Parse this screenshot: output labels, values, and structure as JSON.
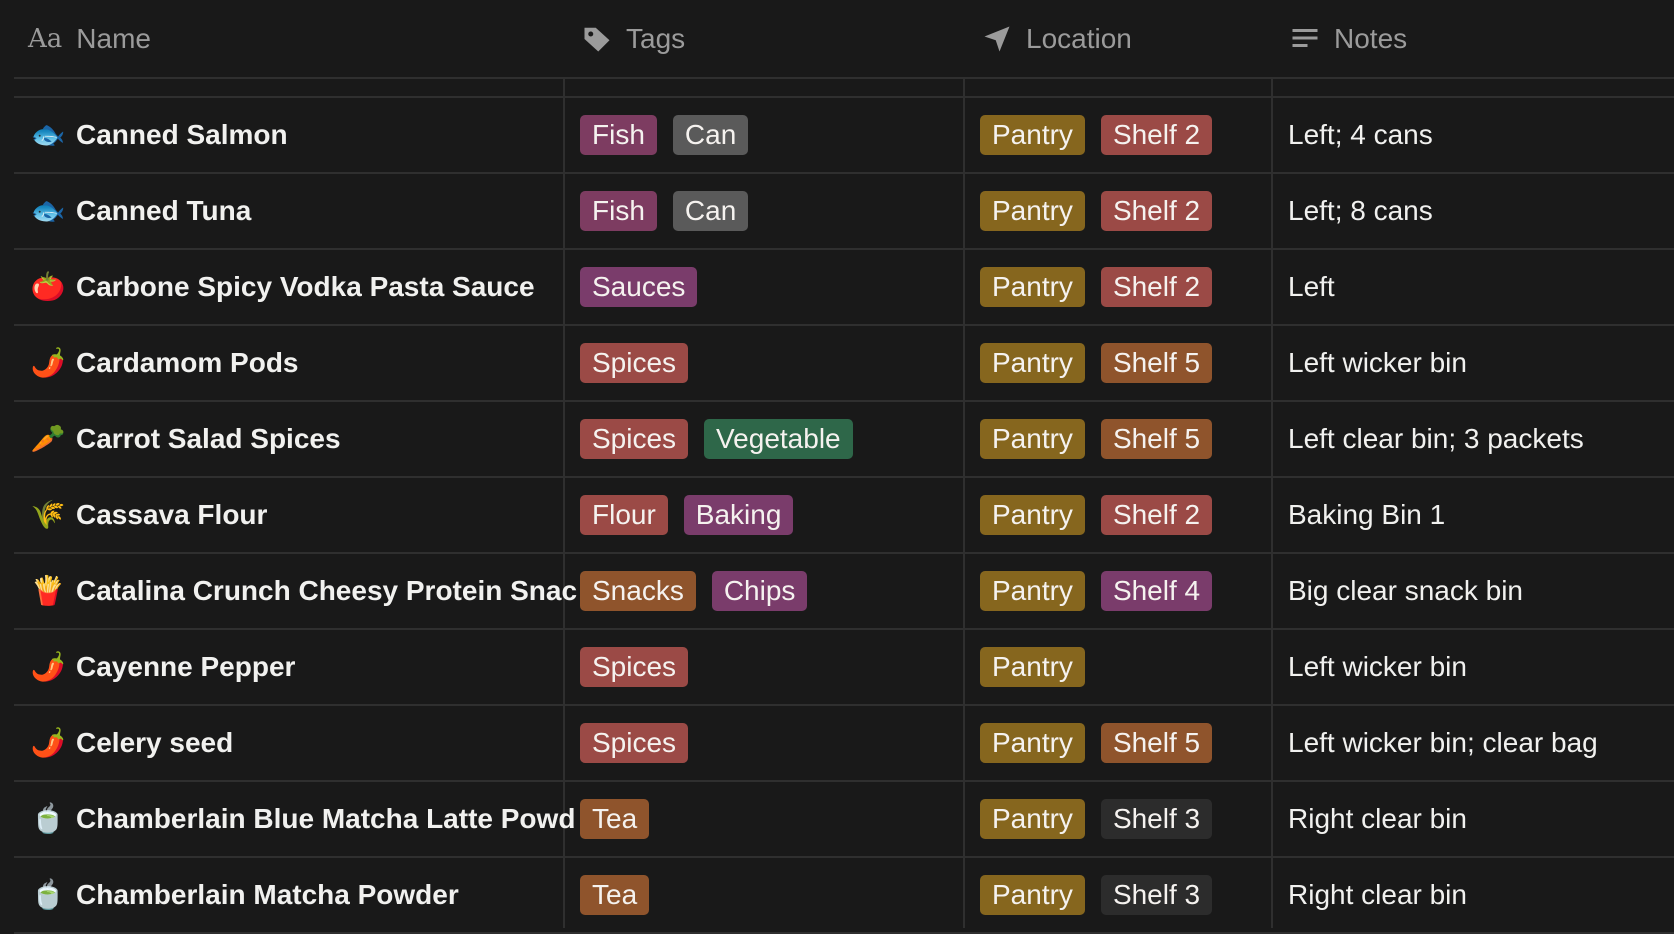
{
  "headers": {
    "name": "Name",
    "tags": "Tags",
    "location": "Location",
    "notes": "Notes",
    "name_icon_text": "Aa"
  },
  "icons": {
    "name_col": "text-aa-icon",
    "tags_col": "tag-icon",
    "location_col": "location-arrow-icon",
    "notes_col": "text-lines-icon"
  },
  "tag_colors": {
    "Fish": "#7d3c61",
    "Can": "#5a5a5a",
    "Sauces": "#7a3c6b",
    "Spices": "#9b4a46",
    "Vegetable": "#2e6749",
    "Flour": "#9b4a46",
    "Baking": "#7a3c6b",
    "Snacks": "#8f542c",
    "Chips": "#7a3c6b",
    "Tea": "#8f542c"
  },
  "location_colors": {
    "Pantry": "#86661e",
    "Shelf 2": "#9b4a46",
    "Shelf 5": "#8f542c",
    "Shelf 4": "#7a3c6b",
    "Shelf 3": "#2c2c2c"
  },
  "rows": [
    {
      "emoji": "🐟",
      "icon": "fish-icon",
      "name": "Canned Salmon",
      "tags": [
        "Fish",
        "Can"
      ],
      "location": [
        "Pantry",
        "Shelf 2"
      ],
      "notes": "Left; 4 cans"
    },
    {
      "emoji": "🐟",
      "icon": "fish-icon",
      "name": "Canned Tuna",
      "tags": [
        "Fish",
        "Can"
      ],
      "location": [
        "Pantry",
        "Shelf 2"
      ],
      "notes": "Left; 8 cans"
    },
    {
      "emoji": "🍅",
      "icon": "tomato-icon",
      "name": "Carbone Spicy Vodka Pasta Sauce",
      "tags": [
        "Sauces"
      ],
      "location": [
        "Pantry",
        "Shelf 2"
      ],
      "notes": "Left"
    },
    {
      "emoji": "🌶️",
      "icon": "chili-pepper-icon",
      "name": "Cardamom Pods",
      "tags": [
        "Spices"
      ],
      "location": [
        "Pantry",
        "Shelf 5"
      ],
      "notes": "Left wicker bin"
    },
    {
      "emoji": "🥕",
      "icon": "carrot-icon",
      "name": "Carrot Salad Spices",
      "tags": [
        "Spices",
        "Vegetable"
      ],
      "location": [
        "Pantry",
        "Shelf 5"
      ],
      "notes": "Left clear bin; 3 packets"
    },
    {
      "emoji": "🌾",
      "icon": "wheat-icon",
      "name": "Cassava Flour",
      "tags": [
        "Flour",
        "Baking"
      ],
      "location": [
        "Pantry",
        "Shelf 2"
      ],
      "notes": "Baking Bin 1"
    },
    {
      "emoji": "🍟",
      "icon": "fries-icon",
      "name": "Catalina Crunch Cheesy Protein Snac",
      "tags": [
        "Snacks",
        "Chips"
      ],
      "location": [
        "Pantry",
        "Shelf 4"
      ],
      "notes": "Big clear snack bin"
    },
    {
      "emoji": "🌶️",
      "icon": "chili-pepper-icon",
      "name": "Cayenne Pepper",
      "tags": [
        "Spices"
      ],
      "location": [
        "Pantry"
      ],
      "notes": "Left wicker bin"
    },
    {
      "emoji": "🌶️",
      "icon": "chili-pepper-icon",
      "name": "Celery seed",
      "tags": [
        "Spices"
      ],
      "location": [
        "Pantry",
        "Shelf 5"
      ],
      "notes": "Left wicker bin; clear bag"
    },
    {
      "emoji": "🍵",
      "icon": "tea-cup-icon",
      "name": "Chamberlain Blue Matcha Latte Powd",
      "tags": [
        "Tea"
      ],
      "location": [
        "Pantry",
        "Shelf 3"
      ],
      "notes": "Right clear bin"
    },
    {
      "emoji": "🍵",
      "icon": "tea-cup-icon",
      "name": "Chamberlain Matcha Powder",
      "tags": [
        "Tea"
      ],
      "location": [
        "Pantry",
        "Shelf 3"
      ],
      "notes": "Right clear bin"
    }
  ]
}
